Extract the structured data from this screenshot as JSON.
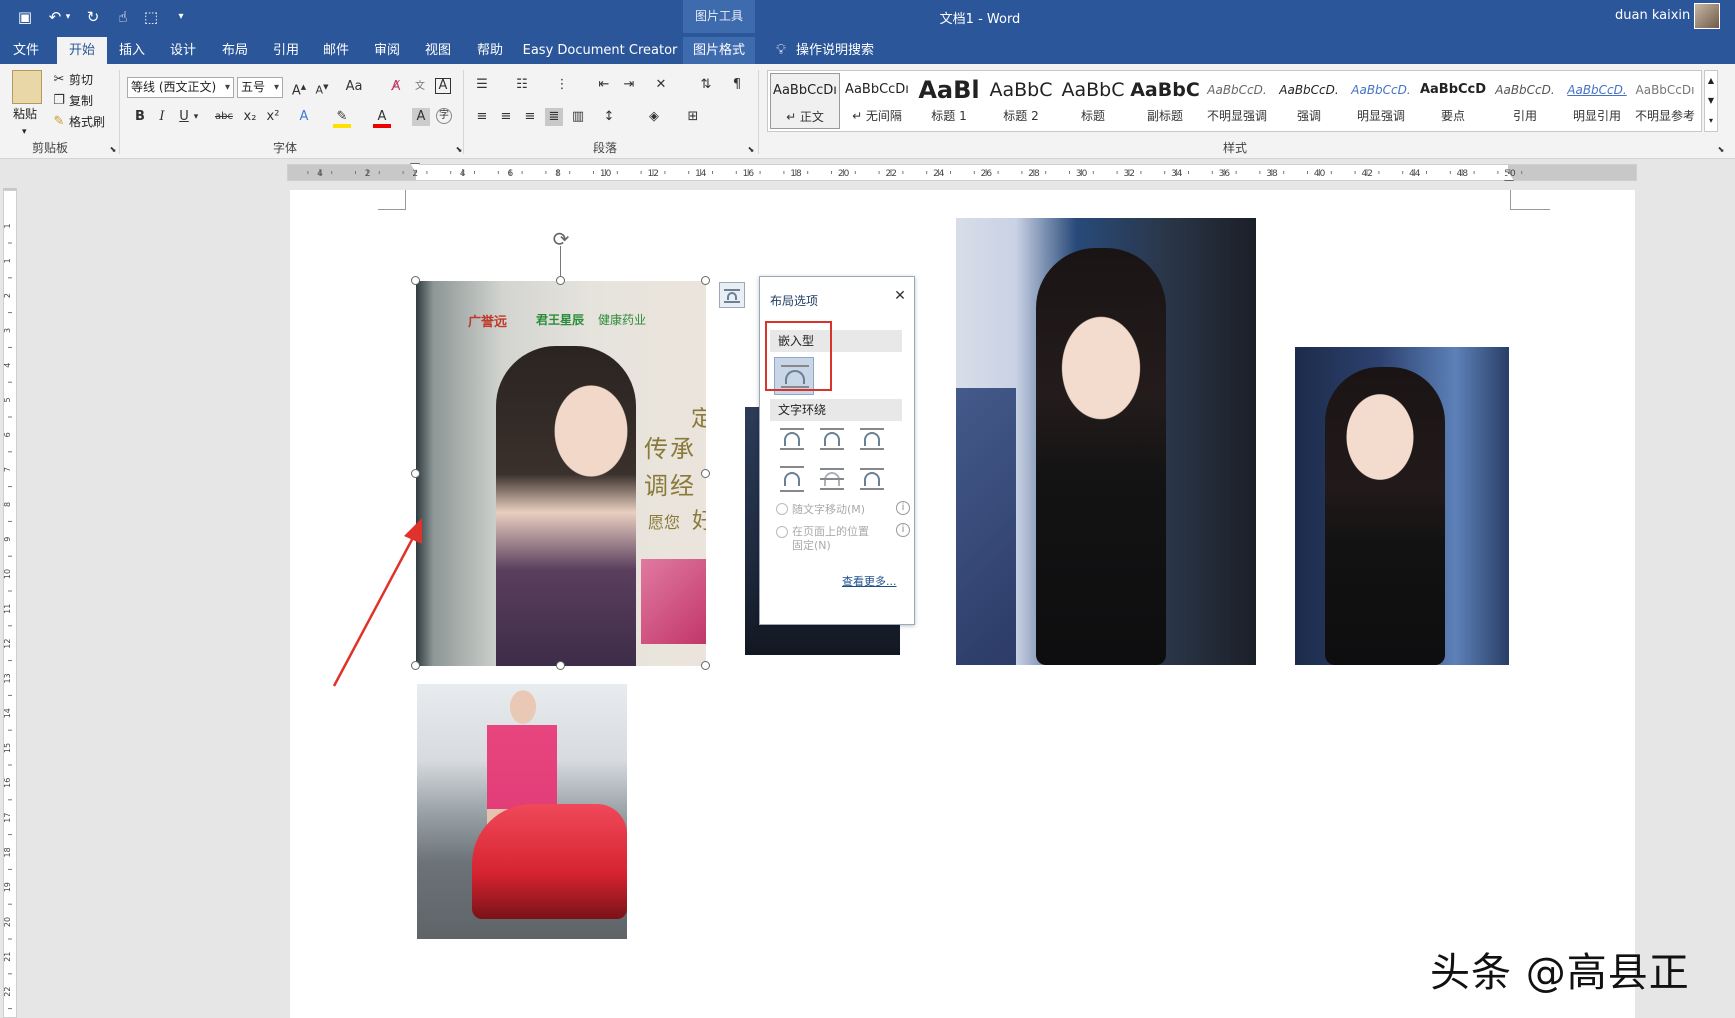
{
  "titlebar": {
    "context_tool_group": "图片工具",
    "document_title": "文档1  -  Word",
    "user_name": "duan kaixin"
  },
  "tabs": [
    "文件",
    "开始",
    "插入",
    "设计",
    "布局",
    "引用",
    "邮件",
    "审阅",
    "视图",
    "帮助",
    "Easy Document Creator",
    "图片格式"
  ],
  "active_tab": "开始",
  "tell_me": "操作说明搜索",
  "clipboard": {
    "paste": "粘贴",
    "cut": "剪切",
    "copy": "复制",
    "format_painter": "格式刷",
    "group": "剪贴板"
  },
  "font": {
    "name": "等线 (西文正文)",
    "size": "五号",
    "group": "字体",
    "change_case": "Aa",
    "bold": "B",
    "italic": "I",
    "underline": "U",
    "strike": "abc",
    "subscript": "x₂",
    "superscript": "x²"
  },
  "paragraph": {
    "group": "段落"
  },
  "styles": {
    "group": "样式",
    "items": [
      {
        "sample": "AaBbCcDı",
        "name": "↵ 正文"
      },
      {
        "sample": "AaBbCcDı",
        "name": "↵ 无间隔"
      },
      {
        "sample": "AaBl",
        "name": "标题 1"
      },
      {
        "sample": "AaBbC",
        "name": "标题 2"
      },
      {
        "sample": "AaBbC",
        "name": "标题"
      },
      {
        "sample": "AaBbC",
        "name": "副标题"
      },
      {
        "sample": "AaBbCcD.",
        "name": "不明显强调"
      },
      {
        "sample": "AaBbCcD.",
        "name": "强调"
      },
      {
        "sample": "AaBbCcD.",
        "name": "明显强调"
      },
      {
        "sample": "AaBbCcD",
        "name": "要点"
      },
      {
        "sample": "AaBbCcD.",
        "name": "引用"
      },
      {
        "sample": "AaBbCcD.",
        "name": "明显引用"
      },
      {
        "sample": "AaBbCcDı",
        "name": "不明显参考"
      }
    ]
  },
  "ruler": {
    "labels": [
      "4",
      "2",
      "2",
      "4",
      "6",
      "8",
      "10",
      "12",
      "14",
      "16",
      "18",
      "20",
      "22",
      "24",
      "26",
      "28",
      "30",
      "32",
      "34",
      "36",
      "38",
      "40",
      "42",
      "44",
      "48",
      "50"
    ],
    "vlabels": [
      "1",
      "1",
      "2",
      "3",
      "4",
      "5",
      "6",
      "7",
      "8",
      "9",
      "10",
      "11",
      "12",
      "13",
      "14",
      "15",
      "16",
      "17",
      "18",
      "19",
      "20",
      "21",
      "22"
    ]
  },
  "layout_panel": {
    "title": "布局选项",
    "inline_section": "嵌入型",
    "wrap_section": "文字环绕",
    "move_with_text": "随文字移动(M)",
    "fix_position": "在页面上的位置",
    "fix_position_2": "固定(N)",
    "see_more": "查看更多..."
  },
  "poster_text": {
    "brand1": "广誉远",
    "brand2": "君王星辰",
    "brand3": "健康药业",
    "line1": "传承",
    "line2": "调经",
    "line3": "愿您",
    "side": "定",
    "small": "好"
  },
  "watermark": "头条 @高县正",
  "colors": {
    "accent": "#2b579a",
    "highlight_box": "#d9342b",
    "arrow": "#e0322a"
  }
}
